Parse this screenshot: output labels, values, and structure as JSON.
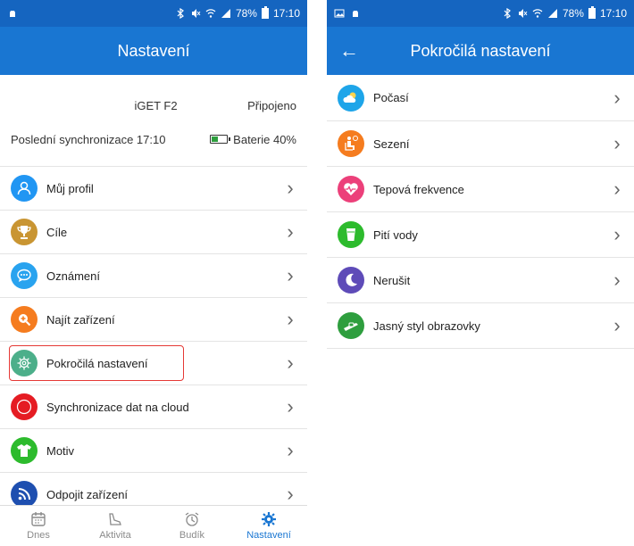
{
  "left_screen": {
    "status": {
      "battery": "78%",
      "time": "17:10"
    },
    "appbar_title": "Nastavení",
    "device": {
      "name": "iGET F2",
      "state": "Připojeno"
    },
    "sync": {
      "label": "Poslední synchronizace 17:10",
      "battery_label": "Baterie 40%",
      "battery_level": 0.4
    },
    "items": [
      {
        "label": "Můj profil",
        "icon": "person-icon",
        "color": "#2196f3"
      },
      {
        "label": "Cíle",
        "icon": "trophy-icon",
        "color": "#c99532"
      },
      {
        "label": "Oznámení",
        "icon": "chat-bubble-icon",
        "color": "#29a3ef"
      },
      {
        "label": "Najít zařízení",
        "icon": "search-plus-icon",
        "color": "#f57c1f"
      },
      {
        "label": "Pokročilá nastavení",
        "icon": "gear-icon",
        "color": "#4caf8a"
      },
      {
        "label": "Synchronizace dat na cloud",
        "icon": "record-icon",
        "color": "#e51c23"
      },
      {
        "label": "Motiv",
        "icon": "tshirt-icon",
        "color": "#2dbb2d"
      },
      {
        "label": "Odpojit zařízení",
        "icon": "rss-icon",
        "color": "#1e4fb0"
      }
    ],
    "tabs": [
      {
        "label": "Dnes",
        "icon": "calendar-icon"
      },
      {
        "label": "Aktivita",
        "icon": "shoe-icon"
      },
      {
        "label": "Budík",
        "icon": "alarm-clock-icon"
      },
      {
        "label": "Nastavení",
        "icon": "gear-icon"
      }
    ]
  },
  "right_screen": {
    "status": {
      "battery": "78%",
      "time": "17:10"
    },
    "appbar_title": "Pokročilá nastavení",
    "items": [
      {
        "label": "Počasí",
        "icon": "weather-icon",
        "color": "#1ea5e9"
      },
      {
        "label": "Sezení",
        "icon": "sitting-icon",
        "color": "#f57c1f"
      },
      {
        "label": "Tepová frekvence",
        "icon": "heart-rate-icon",
        "color": "#ec407a"
      },
      {
        "label": "Pití vody",
        "icon": "water-glass-icon",
        "color": "#2dbb2d"
      },
      {
        "label": "Nerušit",
        "icon": "moon-icon",
        "color": "#5e4bb8"
      },
      {
        "label": "Jasný styl obrazovky",
        "icon": "wrist-icon",
        "color": "#2e9e3e"
      }
    ]
  }
}
